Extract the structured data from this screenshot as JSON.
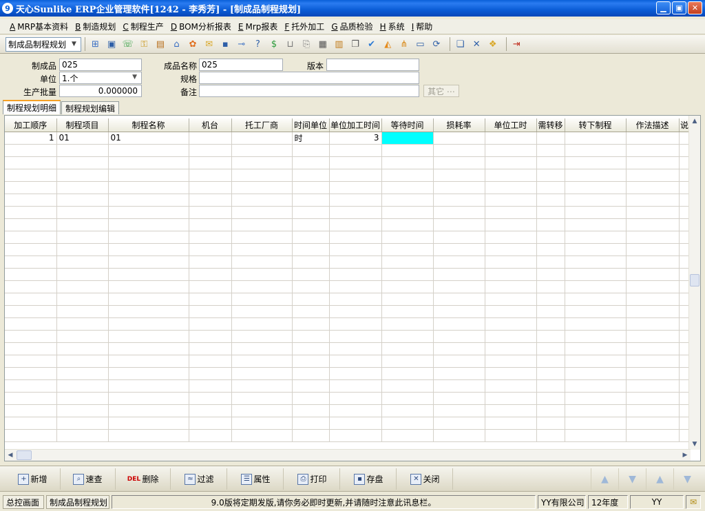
{
  "window": {
    "title": "天心Sunlike ERP企业管理软件[1242 - 李秀芳] - [制成品制程规划]",
    "icon_text": "9",
    "minimize": "▁",
    "maximize": "▣",
    "close": "✕"
  },
  "menu": [
    {
      "acc": "A",
      "label": "MRP基本资料"
    },
    {
      "acc": "B",
      "label": "制造规划"
    },
    {
      "acc": "C",
      "label": "制程生产"
    },
    {
      "acc": "D",
      "label": "BOM分析报表"
    },
    {
      "acc": "E",
      "label": "Mrp报表"
    },
    {
      "acc": "F",
      "label": "托外加工"
    },
    {
      "acc": "G",
      "label": "品质检验"
    },
    {
      "acc": "H",
      "label": "系统"
    },
    {
      "acc": "I",
      "label": "帮助"
    }
  ],
  "toolbar": {
    "select_value": "制成品制程规划",
    "icons": [
      {
        "name": "tree-icon",
        "glyph": "⊞",
        "color": "#3a6fc4"
      },
      {
        "name": "monitor-icon",
        "glyph": "▣",
        "color": "#2e5fa8"
      },
      {
        "name": "phone-icon",
        "glyph": "☏",
        "color": "#2a9a3a"
      },
      {
        "name": "lock-icon",
        "glyph": "⚿",
        "color": "#c9961a"
      },
      {
        "name": "briefcase-icon",
        "glyph": "▤",
        "color": "#b8701e"
      },
      {
        "name": "home-icon",
        "glyph": "⌂",
        "color": "#3a6fc4"
      },
      {
        "name": "users-icon",
        "glyph": "✿",
        "color": "#e07020"
      },
      {
        "name": "mail-icon",
        "glyph": "✉",
        "color": "#d9a82a"
      },
      {
        "name": "book-icon",
        "glyph": "▪",
        "color": "#2e5fa8"
      },
      {
        "name": "key-icon",
        "glyph": "⊸",
        "color": "#3a6fc4"
      },
      {
        "name": "help-icon",
        "glyph": "?",
        "color": "#2e5fa8"
      },
      {
        "name": "money-icon",
        "glyph": "$",
        "color": "#2a9a3a"
      },
      {
        "name": "cart-icon",
        "glyph": "⊔",
        "color": "#7a7a7a"
      },
      {
        "name": "document-icon",
        "glyph": "⎘",
        "color": "#7a7a7a"
      },
      {
        "name": "calculator-icon",
        "glyph": "▦",
        "color": "#555"
      },
      {
        "name": "cabinet-icon",
        "glyph": "▥",
        "color": "#c07a18"
      },
      {
        "name": "copy-icon",
        "glyph": "❐",
        "color": "#555"
      },
      {
        "name": "check-icon",
        "glyph": "✔",
        "color": "#2e7bd4"
      },
      {
        "name": "bell-icon",
        "glyph": "◭",
        "color": "#e58a1a"
      },
      {
        "name": "hierarchy-icon",
        "glyph": "⋔",
        "color": "#d98a1a"
      },
      {
        "name": "screen-icon",
        "glyph": "▭",
        "color": "#2e5fa8"
      },
      {
        "name": "refresh-icon",
        "glyph": "⟳",
        "color": "#2e5fa8"
      },
      {
        "name": "window-icon",
        "glyph": "❏",
        "color": "#2e5fa8"
      },
      {
        "name": "close-window-icon",
        "glyph": "✕",
        "color": "#2e5fa8"
      },
      {
        "name": "cascade-icon",
        "glyph": "❖",
        "color": "#d9a82a"
      },
      {
        "name": "exit-icon",
        "glyph": "⇥",
        "color": "#c03020"
      }
    ]
  },
  "form": {
    "product_label": "制成品",
    "product_value": "025",
    "unit_label": "单位",
    "unit_value": "1.个",
    "batch_label": "生产批量",
    "batch_value": "0.000000",
    "product_name_label": "成品名称",
    "product_name_value": "025",
    "spec_label": "规格",
    "spec_value": "",
    "remark_label": "备注",
    "remark_value": "",
    "version_label": "版本",
    "version_value": "",
    "other_button": "其它 ⋯"
  },
  "tabs": [
    {
      "label": "制程规划明细",
      "active": true
    },
    {
      "label": "制程规划编辑",
      "active": false
    }
  ],
  "grid": {
    "columns": [
      "加工顺序",
      "制程项目",
      "制程名称",
      "机台",
      "托工厂商",
      "时间单位",
      "单位加工时间",
      "等待时间",
      "损耗率",
      "单位工时",
      "需转移",
      "转下制程",
      "作法描述",
      "说"
    ],
    "rows": [
      [
        "1",
        "01",
        "01",
        "",
        "",
        "时",
        "3",
        "",
        "",
        "",
        "",
        "",
        "",
        ""
      ]
    ],
    "empty_rows": 24
  },
  "actions": [
    {
      "name": "add-button",
      "icon": "add-icon",
      "glyph": "+",
      "label": "新增"
    },
    {
      "name": "quick-search-button",
      "icon": "search-icon",
      "glyph": "⌕",
      "label": "速查"
    },
    {
      "name": "delete-button",
      "icon": "delete-icon",
      "glyph": "DEL",
      "label": "删除"
    },
    {
      "name": "filter-button",
      "icon": "filter-icon",
      "glyph": "≈",
      "label": "过滤"
    },
    {
      "name": "properties-button",
      "icon": "properties-icon",
      "glyph": "☰",
      "label": "属性"
    },
    {
      "name": "print-button",
      "icon": "printer-icon",
      "glyph": "⎙",
      "label": "打印"
    },
    {
      "name": "save-button",
      "icon": "save-icon",
      "glyph": "▪",
      "label": "存盘"
    },
    {
      "name": "close-button",
      "icon": "close-icon",
      "glyph": "✕",
      "label": "关闭"
    }
  ],
  "nav": [
    "▲",
    "▼",
    "▲",
    "▼"
  ],
  "status": {
    "home": "总控画面",
    "current": "制成品制程规划",
    "message": "9.0版将定期发版,请你务必即时更新,并请随时注意此讯息栏。",
    "company": "YY有限公司",
    "year": "12年度",
    "user": "YY",
    "mail_icon": "✉"
  }
}
